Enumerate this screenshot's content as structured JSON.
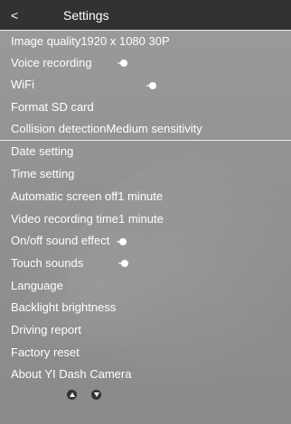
{
  "header": {
    "back_label": "<",
    "title": "Settings"
  },
  "settings": [
    {
      "label": "Image quality",
      "value": "1920 x 1080 30P"
    },
    {
      "label": "Voice recording",
      "toggle": "on"
    },
    {
      "label": "WiFi",
      "toggle": "on"
    },
    {
      "label": "Format SD card"
    },
    {
      "label": "Collision detection",
      "value": "Medium sensitivity"
    },
    {
      "label": "Date setting"
    },
    {
      "label": "Time setting"
    },
    {
      "label": "Automatic screen off",
      "value": "1 minute"
    },
    {
      "label": "Video recording time",
      "value": "1 minute"
    },
    {
      "label": "On/off sound effect",
      "toggle": "on"
    },
    {
      "label": "Touch sounds",
      "toggle": "on"
    },
    {
      "label": "Language"
    },
    {
      "label": "Backlight brightness"
    },
    {
      "label": "Driving report"
    },
    {
      "label": "Factory reset"
    },
    {
      "label": "About YI Dash Camera"
    }
  ],
  "nav": {
    "up_icon": "chevron-up-icon",
    "down_icon": "chevron-down-icon"
  },
  "colors": {
    "header_bg": "#323232",
    "list_bg": "#959595",
    "text": "#ffffff",
    "separator": "#efefef"
  }
}
